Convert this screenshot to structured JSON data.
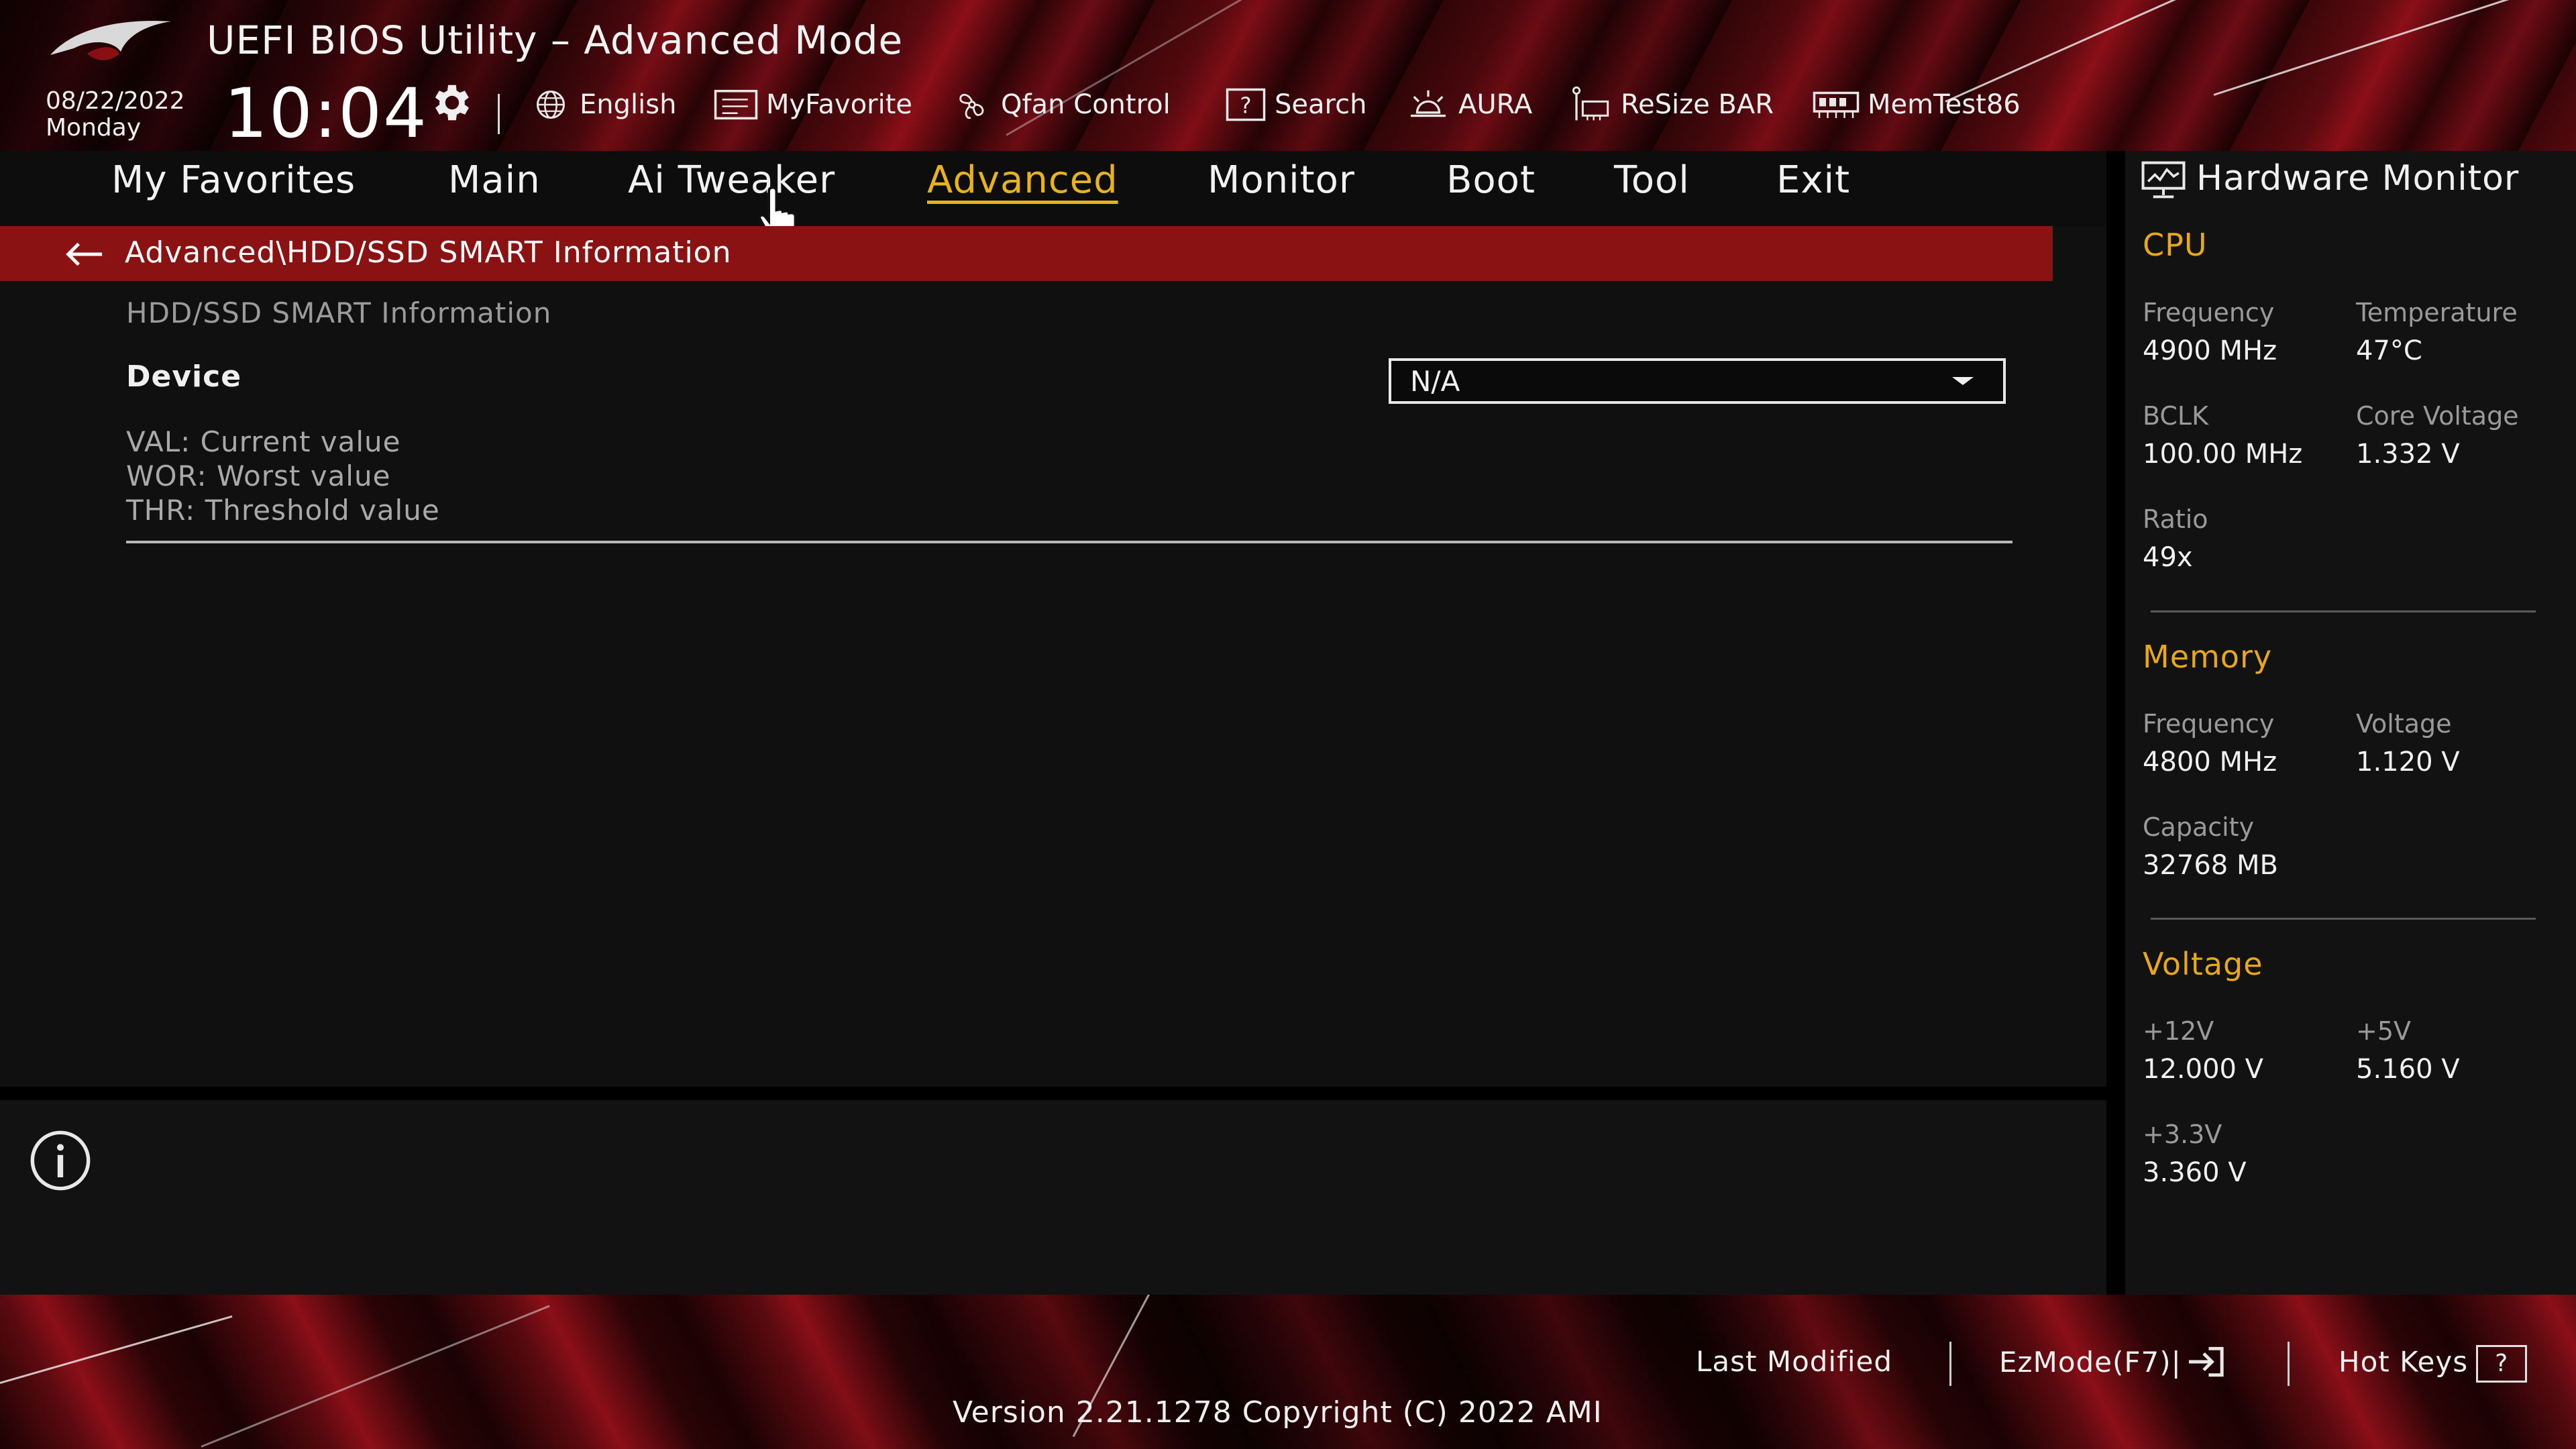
{
  "header": {
    "title": "UEFI BIOS Utility – Advanced Mode",
    "date": "08/22/2022",
    "day": "Monday",
    "time": "10:04"
  },
  "toolbar": [
    {
      "label": "English",
      "icon": "globe-icon"
    },
    {
      "label": "MyFavorite",
      "icon": "favorite-icon"
    },
    {
      "label": "Qfan Control",
      "icon": "fan-icon"
    },
    {
      "label": "Search",
      "icon": "search-icon"
    },
    {
      "label": "AURA",
      "icon": "aura-icon"
    },
    {
      "label": "ReSize BAR",
      "icon": "resize-bar-icon"
    },
    {
      "label": "MemTest86",
      "icon": "memory-icon"
    }
  ],
  "tabs": [
    {
      "label": "My Favorites"
    },
    {
      "label": "Main"
    },
    {
      "label": "Ai Tweaker"
    },
    {
      "label": "Advanced",
      "active": true
    },
    {
      "label": "Monitor"
    },
    {
      "label": "Boot"
    },
    {
      "label": "Tool"
    },
    {
      "label": "Exit"
    }
  ],
  "main": {
    "breadcrumb": "Advanced\\HDD/SSD SMART Information",
    "section_title": "HDD/SSD SMART Information",
    "device_label": "Device",
    "device_value": "N/A",
    "legend": [
      "VAL:  Current value",
      "WOR: Worst value",
      "THR:  Threshold value"
    ]
  },
  "hardware_monitor": {
    "title": "Hardware Monitor",
    "cpu": {
      "heading": "CPU",
      "frequency_label": "Frequency",
      "frequency": "4900 MHz",
      "temperature_label": "Temperature",
      "temperature": "47°C",
      "bclk_label": "BCLK",
      "bclk": "100.00 MHz",
      "core_voltage_label": "Core Voltage",
      "core_voltage": "1.332 V",
      "ratio_label": "Ratio",
      "ratio": "49x"
    },
    "memory": {
      "heading": "Memory",
      "frequency_label": "Frequency",
      "frequency": "4800 MHz",
      "voltage_label": "Voltage",
      "voltage": "1.120 V",
      "capacity_label": "Capacity",
      "capacity": "32768 MB"
    },
    "voltage": {
      "heading": "Voltage",
      "v12_label": "+12V",
      "v12": "12.000 V",
      "v5_label": "+5V",
      "v5": "5.160 V",
      "v33_label": "+3.3V",
      "v33": "3.360 V"
    }
  },
  "footer": {
    "last_modified": "Last Modified",
    "ezmode": "EzMode(F7)|",
    "hot_keys": "Hot Keys",
    "hot_keys_box": "?",
    "version": "Version 2.21.1278 Copyright (C) 2022 AMI"
  },
  "colors": {
    "accent": "#e8a81a",
    "breadcrumb_bg": "#8a1212",
    "panel_bg": "#101010"
  }
}
